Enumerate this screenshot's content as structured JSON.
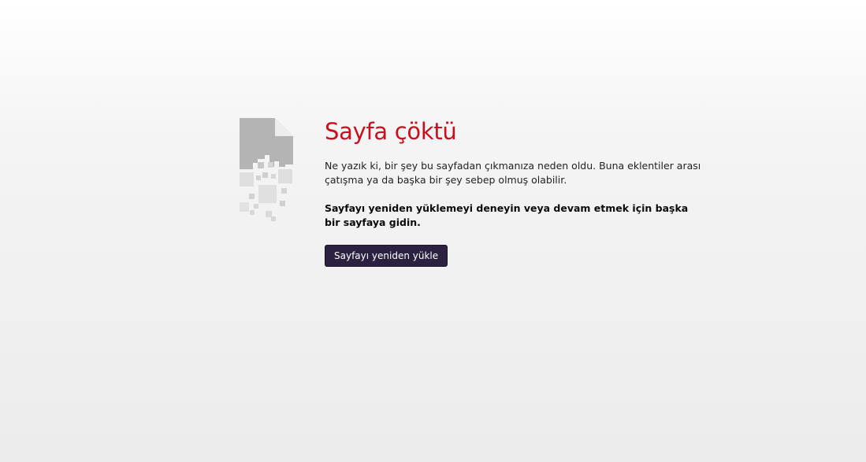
{
  "page": {
    "icon": "broken-page-icon",
    "title": "Sayfa çöktü",
    "description": "Ne yazık ki, bir şey bu sayfadan çıkmanıza neden oldu. Buna eklentiler arası çatışma ya da başka bir şey sebep olmuş olabilir.",
    "advice": "Sayfayı yeniden yüklemeyi deneyin veya devam etmek için başka bir sayfaya gidin.",
    "reload_label": "Sayfayı yeniden yükle"
  },
  "colors": {
    "title": "#c80f1e",
    "button_bg": "#2b2140",
    "icon_dark": "#b4b4b4",
    "icon_light": "#dcdcdc"
  }
}
